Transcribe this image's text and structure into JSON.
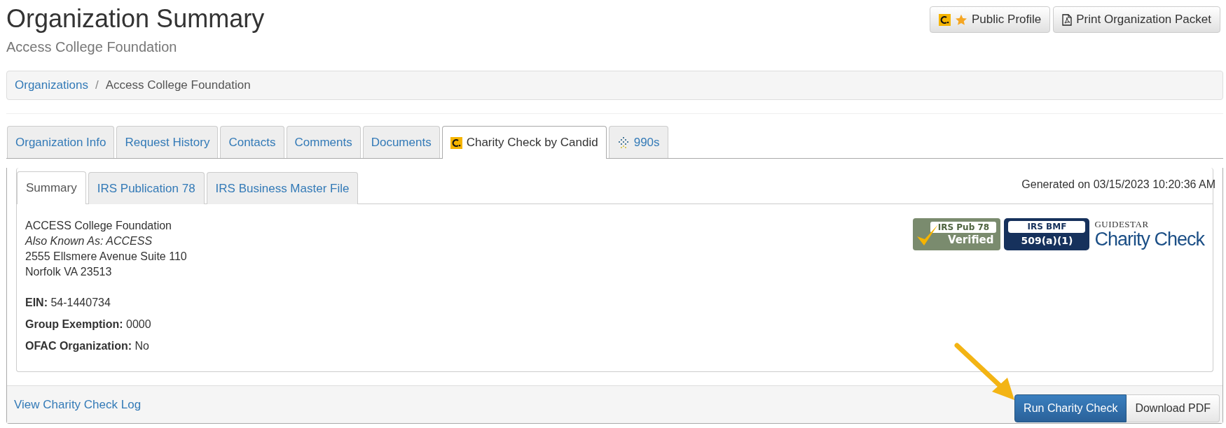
{
  "page": {
    "title": "Organization Summary",
    "subtitle": "Access College Foundation"
  },
  "header_buttons": [
    {
      "label": "Public Profile",
      "kind": "profile"
    },
    {
      "label": "Print Organization Packet",
      "kind": "pdf"
    }
  ],
  "breadcrumb_separator": "/",
  "breadcrumb": [
    {
      "label": "Organizations",
      "kind": "link"
    },
    {
      "label": "Access College Foundation",
      "kind": "current"
    }
  ],
  "tabs": [
    {
      "label": "Organization Info",
      "selected": false,
      "kind": "plain"
    },
    {
      "label": "Request History",
      "selected": false,
      "kind": "plain"
    },
    {
      "label": "Contacts",
      "selected": false,
      "kind": "plain"
    },
    {
      "label": "Comments",
      "selected": false,
      "kind": "plain"
    },
    {
      "label": "Documents",
      "selected": false,
      "kind": "plain"
    },
    {
      "label": "Charity Check by Candid",
      "selected": true,
      "kind": "candid"
    },
    {
      "label": "990s",
      "selected": false,
      "kind": "grid"
    }
  ],
  "subtabs": [
    {
      "label": "Summary",
      "selected": true
    },
    {
      "label": "IRS Publication 78",
      "selected": false
    },
    {
      "label": "IRS Business Master File",
      "selected": false
    }
  ],
  "generated": "Generated on 03/15/2023 10:20:36 AM",
  "organization": {
    "name": "ACCESS College Foundation",
    "aka": "Also Known As: ACCESS",
    "address_lines": [
      "2555 Ellsmere Avenue Suite 110",
      "Norfolk VA 23513"
    ],
    "fields": [
      {
        "label": "EIN:",
        "value": "54-1440734"
      },
      {
        "label": "Group Exemption:",
        "value": "0000"
      },
      {
        "label": "OFAC Organization:",
        "value": "No"
      }
    ]
  },
  "badges": {
    "pub78": [
      "IRS Pub 78",
      "Verified"
    ],
    "bmf": [
      "IRS BMF",
      "509(a)(1)"
    ],
    "guidestar": [
      "GUIDESTAR",
      "Charity Check"
    ]
  },
  "footer": {
    "link": "View Charity Check Log",
    "buttons": [
      {
        "label": "Run Charity Check",
        "kind": "primary"
      },
      {
        "label": "Download PDF",
        "kind": "default"
      }
    ]
  }
}
